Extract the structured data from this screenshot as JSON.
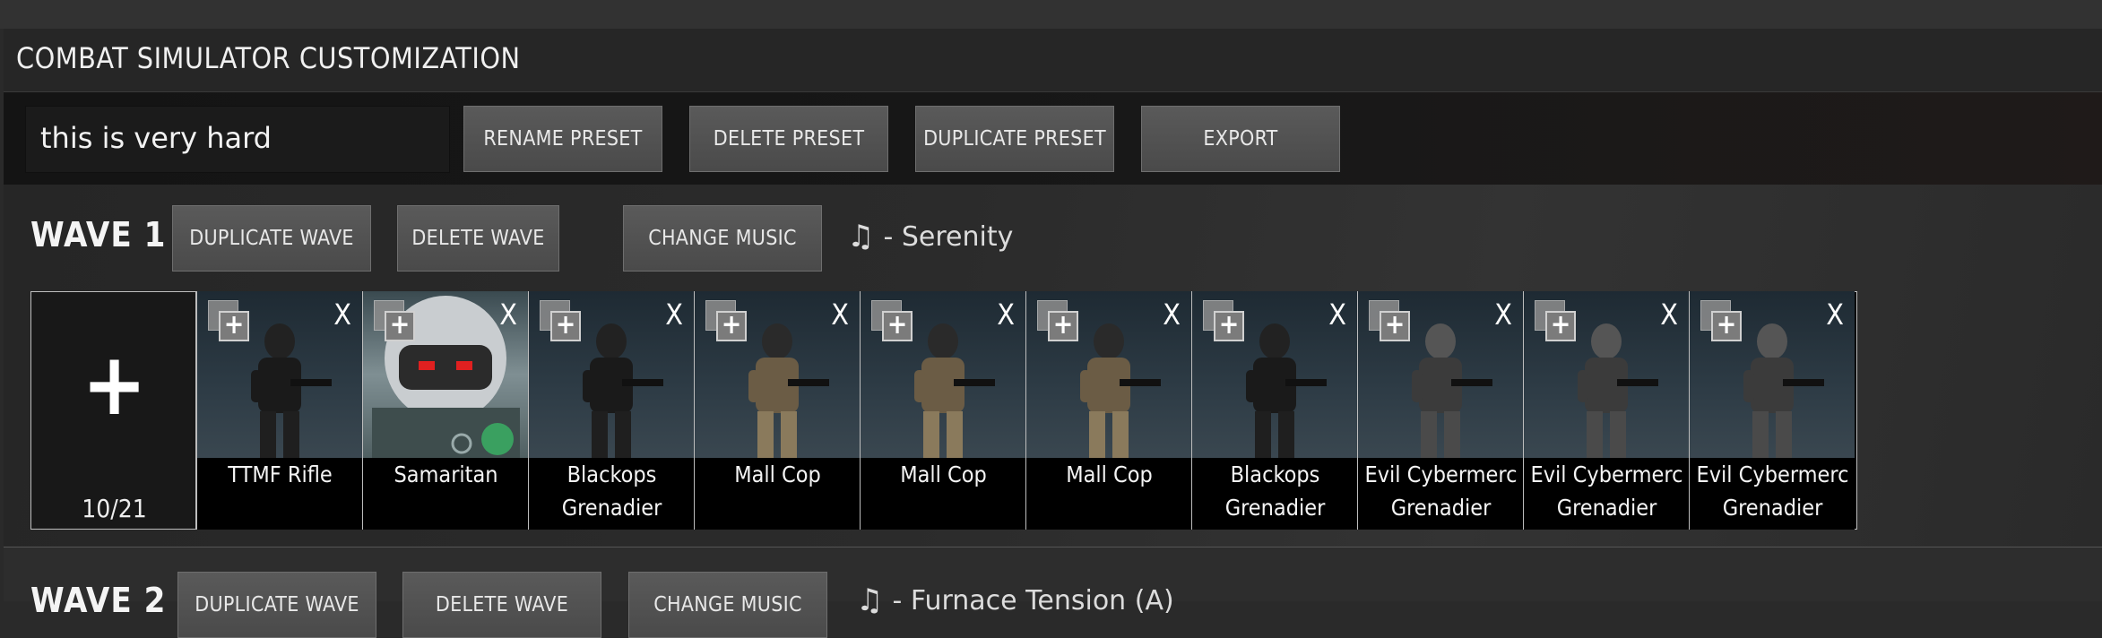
{
  "title": "COMBAT SIMULATOR CUSTOMIZATION",
  "preset": {
    "name_value": "this is very hard",
    "rename_label": "RENAME PRESET",
    "delete_label": "DELETE PRESET",
    "duplicate_label": "DUPLICATE PRESET",
    "export_label": "EXPORT"
  },
  "waves": [
    {
      "label": "WAVE 1",
      "duplicate_label": "DUPLICATE WAVE",
      "delete_label": "DELETE WAVE",
      "music_label": "CHANGE MUSIC",
      "music_note": "♫",
      "music_track": "- Serenity",
      "add_symbol": "+",
      "count": "10/21",
      "enemies": [
        {
          "line1": "TTMF Rifle",
          "line2": "",
          "art": "soldier-dark"
        },
        {
          "line1": "Samaritan",
          "line2": "",
          "art": "heavy-visor"
        },
        {
          "line1": "Blackops",
          "line2": "Grenadier",
          "art": "soldier-dark"
        },
        {
          "line1": "Mall Cop",
          "line2": "",
          "art": "soldier-camo"
        },
        {
          "line1": "Mall Cop",
          "line2": "",
          "art": "soldier-camo"
        },
        {
          "line1": "Mall Cop",
          "line2": "",
          "art": "soldier-camo"
        },
        {
          "line1": "Blackops",
          "line2": "Grenadier",
          "art": "soldier-dark"
        },
        {
          "line1": "Evil Cybermerc",
          "line2": "Grenadier",
          "art": "cyber"
        },
        {
          "line1": "Evil Cybermerc",
          "line2": "Grenadier",
          "art": "cyber"
        },
        {
          "line1": "Evil Cybermerc",
          "line2": "Grenadier",
          "art": "cyber"
        }
      ],
      "card_dup_symbol": "+",
      "card_close_symbol": "X"
    },
    {
      "label": "WAVE 2",
      "duplicate_label": "DUPLICATE WAVE",
      "delete_label": "DELETE WAVE",
      "music_label": "CHANGE MUSIC",
      "music_note": "♫",
      "music_track": "- Furnace Tension (A)"
    }
  ]
}
